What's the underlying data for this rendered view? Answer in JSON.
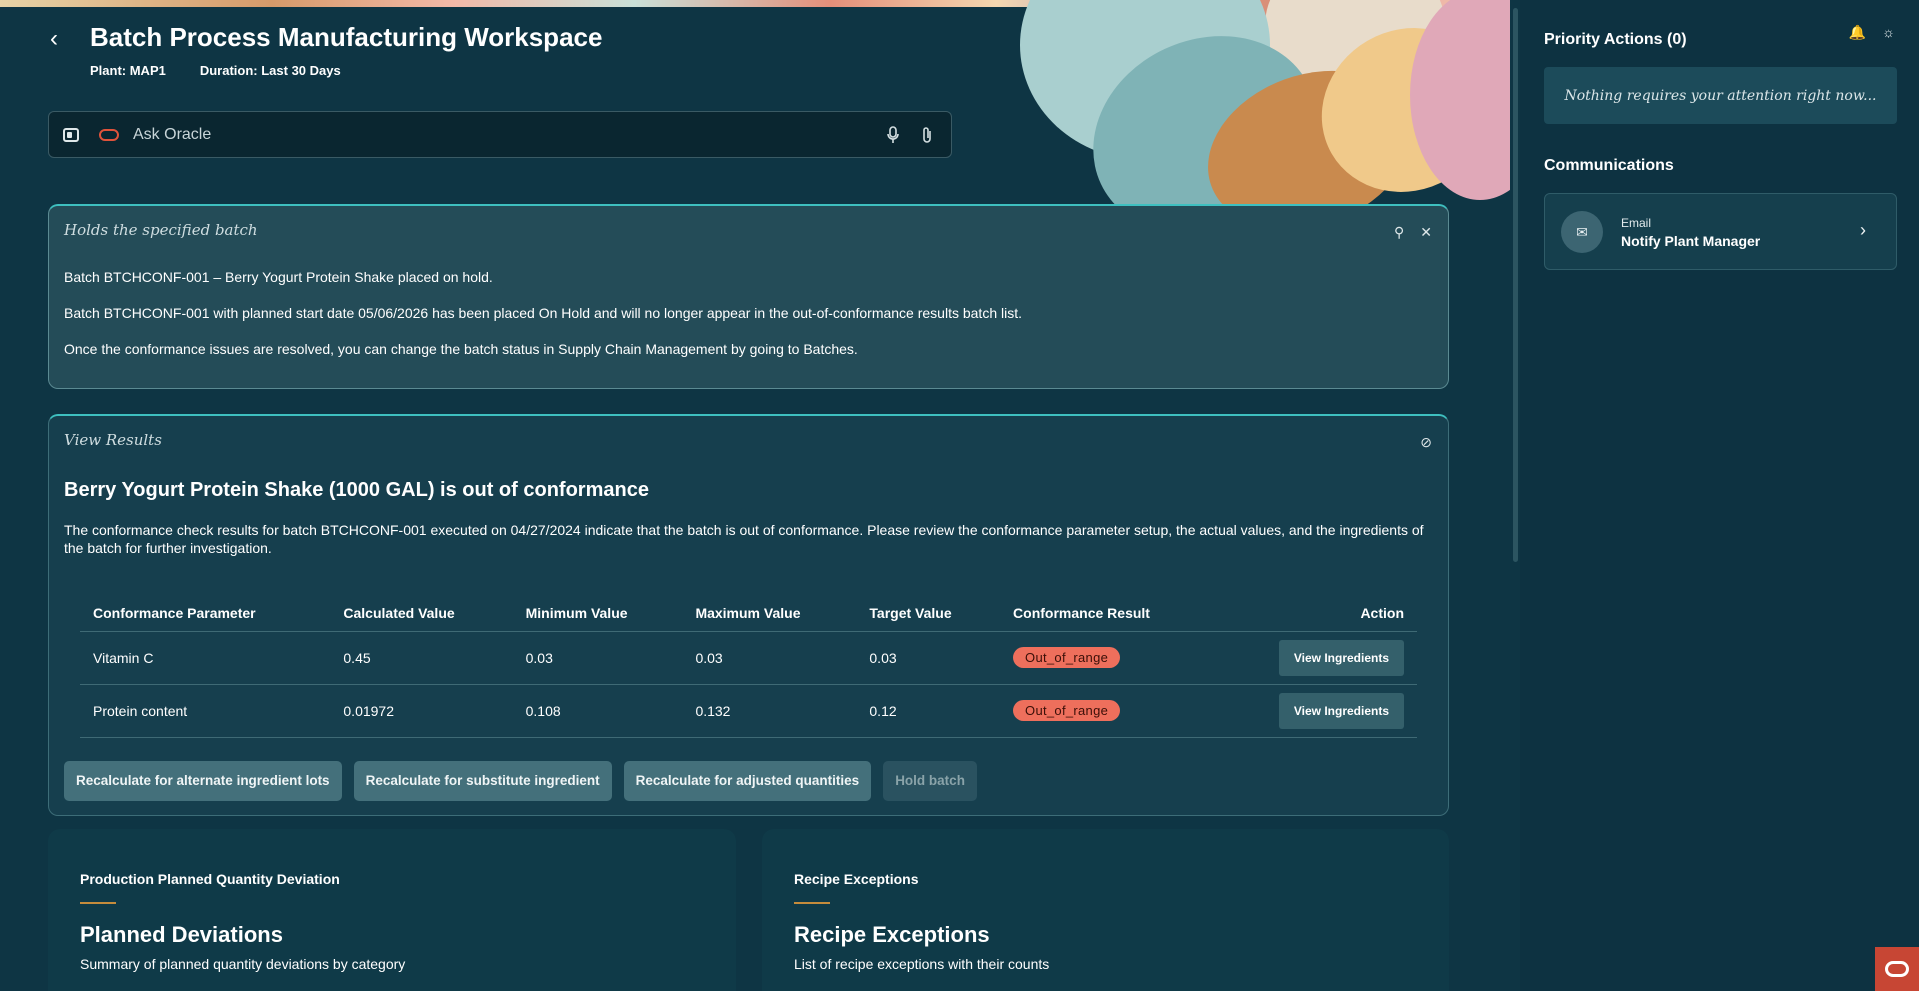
{
  "header": {
    "title": "Batch Process Manufacturing Workspace",
    "plant": "Plant: MAP1",
    "duration": "Duration: Last 30 Days"
  },
  "ask": {
    "placeholder": "Ask Oracle"
  },
  "hold_card": {
    "label": "Holds the specified batch",
    "line1": "Batch BTCHCONF-001 – Berry Yogurt Protein Shake placed on hold.",
    "line2": "Batch BTCHCONF-001 with planned start date 05/06/2026 has been placed On Hold and will no longer appear in the out-of-conformance results batch list.",
    "line3": "Once the conformance issues are resolved, you can change the batch status in Supply Chain Management by going to Batches."
  },
  "results_card": {
    "label": "View Results",
    "title": "Berry Yogurt Protein Shake (1000 GAL) is out of conformance",
    "description": "The conformance check results for batch BTCHCONF-001 executed on 04/27/2024 indicate that the batch is out of conformance. Please review the conformance parameter setup, the actual values, and the ingredients of the batch for further investigation.",
    "columns": [
      "Conformance Parameter",
      "Calculated Value",
      "Minimum Value",
      "Maximum Value",
      "Target Value",
      "Conformance Result",
      "Action"
    ],
    "rows": [
      {
        "parameter": "Vitamin C",
        "calculated": "0.45",
        "min": "0.03",
        "max": "0.03",
        "target": "0.03",
        "result": "Out_of_range",
        "action": "View Ingredients"
      },
      {
        "parameter": "Protein content",
        "calculated": "0.01972",
        "min": "0.108",
        "max": "0.132",
        "target": "0.12",
        "result": "Out_of_range",
        "action": "View Ingredients"
      }
    ],
    "buttons": {
      "alternate": "Recalculate for alternate ingredient lots",
      "substitute": "Recalculate for substitute ingredient",
      "adjusted": "Recalculate for adjusted quantities",
      "hold": "Hold batch"
    }
  },
  "tiles": {
    "left": {
      "kicker": "Production Planned Quantity Deviation",
      "title": "Planned Deviations",
      "subtitle": "Summary of planned quantity deviations by category"
    },
    "right": {
      "kicker": "Recipe Exceptions",
      "title": "Recipe Exceptions",
      "subtitle": "List of recipe exceptions with their counts"
    }
  },
  "sidebar": {
    "priority_title": "Priority Actions (0)",
    "priority_empty": "Nothing requires your attention right now...",
    "communications_title": "Communications",
    "comm_item": {
      "type": "Email",
      "title": "Notify Plant Manager"
    }
  },
  "colors": {
    "accent_teal": "#3ec0c0",
    "badge_out_of_range": "#ee6f5c",
    "oracle_red": "#c74634",
    "background": "#0e3544"
  }
}
